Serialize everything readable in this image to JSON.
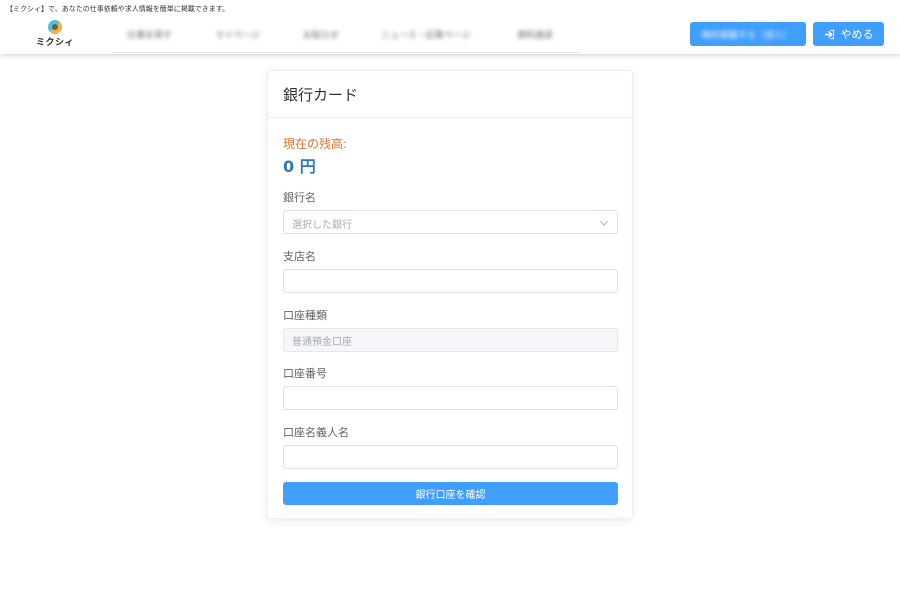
{
  "header": {
    "tagline": "【ミクシィ】で、あなたの仕事依頼や求人情報を簡単に掲載できます。",
    "logo_text": "ミクシィ",
    "nav_items": [
      {
        "label": "仕事を探す"
      },
      {
        "label": "マイページ"
      },
      {
        "label": "お知らせ"
      },
      {
        "label": "ニュース・記事ページ"
      },
      {
        "label": "資料請求"
      }
    ],
    "post_button_label": "無料掲載する（求人）",
    "quit_button_label": "やめる",
    "quit_icon": "sign-in-icon"
  },
  "card": {
    "title": "銀行カード",
    "balance_label": "現在の残高:",
    "balance_value": "0 円",
    "fields": {
      "bank_name": {
        "label": "銀行名",
        "placeholder": "選択した銀行"
      },
      "branch_name": {
        "label": "支店名",
        "value": ""
      },
      "account_type": {
        "label": "口座種類",
        "value": "普通預金口座"
      },
      "account_number": {
        "label": "口座番号",
        "value": ""
      },
      "account_holder": {
        "label": "口座名義人名",
        "value": ""
      }
    },
    "submit_label": "銀行口座を確認"
  },
  "colors": {
    "primary": "#409eff",
    "balance_label": "#e6702e",
    "balance_value": "#2c7bb6"
  }
}
